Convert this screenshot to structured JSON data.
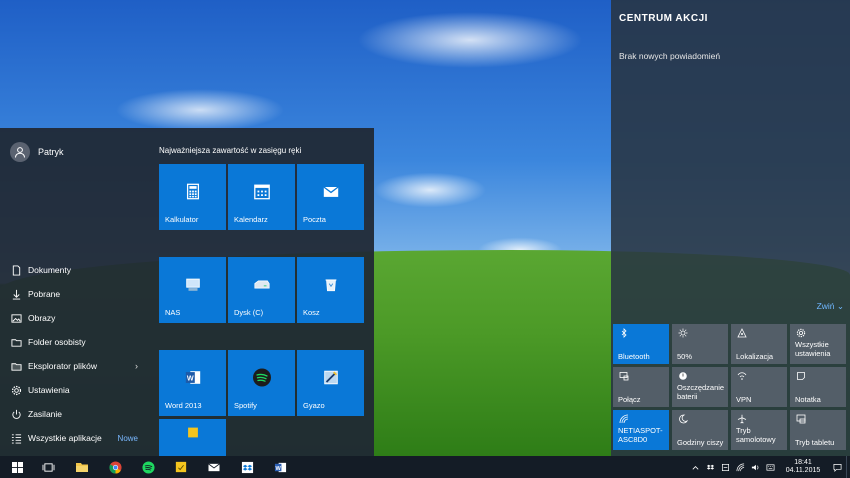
{
  "start_menu": {
    "user_name": "Patryk",
    "tiles_heading": "Najważniejsza zawartość w zasięgu ręki",
    "nav": [
      {
        "label": "Dokumenty",
        "icon": "document-icon"
      },
      {
        "label": "Pobrane",
        "icon": "download-icon"
      },
      {
        "label": "Obrazy",
        "icon": "pictures-icon"
      },
      {
        "label": "Folder osobisty",
        "icon": "user-folder-icon"
      },
      {
        "label": "Eksplorator plików",
        "icon": "file-explorer-icon"
      },
      {
        "label": "Ustawienia",
        "icon": "gear-icon"
      },
      {
        "label": "Zasilanie",
        "icon": "power-icon"
      },
      {
        "label": "Wszystkie aplikacje",
        "icon": "all-apps-icon"
      }
    ],
    "explorer_chevron": "›",
    "all_apps_badge": "Nowe",
    "tiles": [
      {
        "label": "Kalkulator",
        "icon": "calculator-icon"
      },
      {
        "label": "Kalendarz",
        "icon": "calendar-icon"
      },
      {
        "label": "Poczta",
        "icon": "mail-icon"
      },
      {
        "label": "NAS",
        "icon": "network-drive-icon"
      },
      {
        "label": "Dysk (C)",
        "icon": "hard-drive-icon"
      },
      {
        "label": "Kosz",
        "icon": "recycle-bin-icon"
      },
      {
        "label": "Word 2013",
        "icon": "word-icon"
      },
      {
        "label": "Spotify",
        "icon": "spotify-icon"
      },
      {
        "label": "Gyazo",
        "icon": "gyazo-icon"
      }
    ],
    "tile_color": "#0a78d7",
    "extra_tile_color": "#0a78d7"
  },
  "action_center": {
    "title": "CENTRUM AKCJI",
    "empty_text": "Brak nowych powiadomień",
    "collapse_label": "Zwiń ⌄",
    "accent_color": "#0a78d7",
    "quick_actions": [
      {
        "label": "Bluetooth",
        "icon": "bluetooth-icon",
        "on": true
      },
      {
        "label": "50%",
        "icon": "brightness-icon",
        "on": false
      },
      {
        "label": "Lokalizacja",
        "icon": "location-icon",
        "on": false
      },
      {
        "label": "Wszystkie ustawienia",
        "icon": "gear-icon",
        "on": false
      },
      {
        "label": "Połącz",
        "icon": "connect-icon",
        "on": false
      },
      {
        "label": "Oszczędzanie baterii",
        "icon": "battery-saver-icon",
        "on": false
      },
      {
        "label": "VPN",
        "icon": "vpn-icon",
        "on": false
      },
      {
        "label": "Notatka",
        "icon": "note-icon",
        "on": false
      },
      {
        "label": "NETIASPOT-ASC8D0",
        "icon": "wifi-icon",
        "on": true
      },
      {
        "label": "Godziny ciszy",
        "icon": "moon-icon",
        "on": false
      },
      {
        "label": "Tryb samolotowy",
        "icon": "airplane-icon",
        "on": false
      },
      {
        "label": "Tryb tabletu",
        "icon": "tablet-mode-icon",
        "on": false
      }
    ]
  },
  "taskbar": {
    "pinned": [
      "windows-logo-icon",
      "task-view-icon",
      "file-explorer-icon",
      "chrome-icon",
      "spotify-icon",
      "sticky-notes-icon",
      "mail-icon",
      "dropbox-icon",
      "word-icon"
    ],
    "clock_time": "18:41",
    "clock_date": "04.11.2015"
  }
}
